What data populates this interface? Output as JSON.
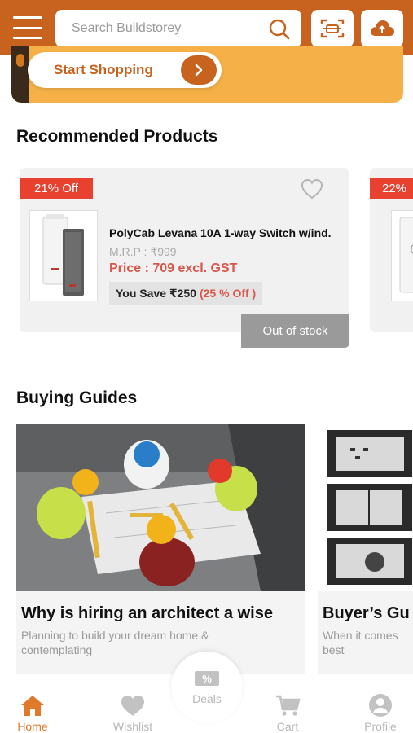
{
  "header": {
    "search_placeholder": "Search Buildstorey",
    "menu_icon": "hamburger-menu-icon",
    "scan_icon": "scan-icon",
    "upload_icon": "cloud-upload-icon",
    "brand_color": "#c8621f"
  },
  "banner": {
    "cta_label": "Start Shopping",
    "background_color": "#f5b147"
  },
  "recommended": {
    "title": "Recommended Products",
    "products": [
      {
        "discount": "21% Off",
        "name": "PolyCab Levana 10A 1-way Switch w/ind.",
        "mrp_label": "M.R.P : ",
        "mrp_value": "₹999",
        "price": "Price : 709 excl. GST",
        "save_label": "You Save ₹250",
        "save_pct": "(25 % Off )",
        "stock_status": "Out of stock"
      },
      {
        "discount": "22%"
      }
    ]
  },
  "guides": {
    "title": "Buying Guides",
    "items": [
      {
        "title": "Why is hiring an architect a wise",
        "desc": "Planning to build your dream home & contemplating"
      },
      {
        "title": "Buyer’s Gu",
        "desc": "When it comes best"
      }
    ]
  },
  "bottom_nav": {
    "items": [
      {
        "label": "Home",
        "icon": "home-icon",
        "active": true
      },
      {
        "label": "Wishlist",
        "icon": "heart-icon"
      },
      {
        "label": "Deals",
        "icon": "deals-tag-icon"
      },
      {
        "label": "Cart",
        "icon": "cart-icon"
      },
      {
        "label": "Profile",
        "icon": "profile-icon"
      }
    ],
    "active_color": "#e07a2a"
  }
}
